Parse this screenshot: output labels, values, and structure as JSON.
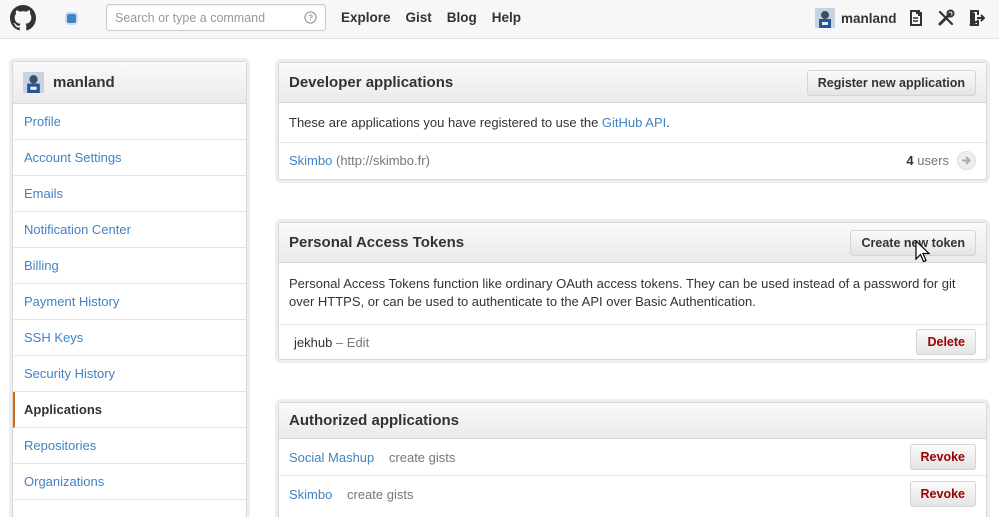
{
  "header": {
    "search_placeholder": "Search or type a command",
    "nav": [
      "Explore",
      "Gist",
      "Blog",
      "Help"
    ],
    "username": "manland",
    "icons": [
      "github-logo-icon",
      "repo-dot-icon",
      "help-circle-icon",
      "create-new-icon",
      "settings-tools-icon",
      "sign-out-icon"
    ],
    "accent": "#4183c4"
  },
  "sidebar": {
    "username": "manland",
    "items": [
      {
        "label": "Profile",
        "active": false
      },
      {
        "label": "Account Settings",
        "active": false
      },
      {
        "label": "Emails",
        "active": false
      },
      {
        "label": "Notification Center",
        "active": false
      },
      {
        "label": "Billing",
        "active": false
      },
      {
        "label": "Payment History",
        "active": false
      },
      {
        "label": "SSH Keys",
        "active": false
      },
      {
        "label": "Security History",
        "active": false
      },
      {
        "label": "Applications",
        "active": true
      },
      {
        "label": "Repositories",
        "active": false
      },
      {
        "label": "Organizations",
        "active": false
      }
    ],
    "active_accent": "#d26911"
  },
  "developer": {
    "title": "Developer applications",
    "button": "Register new application",
    "intro_before": "These are applications you have registered to use the ",
    "intro_link": "GitHub API",
    "intro_after": ".",
    "app": {
      "name": "Skimbo",
      "url": "(http://skimbo.fr)",
      "users_count": "4",
      "users_label": "users"
    }
  },
  "tokens": {
    "title": "Personal Access Tokens",
    "button": "Create new token",
    "description": "Personal Access Tokens function like ordinary OAuth access tokens. They can be used instead of a password for git over HTTPS, or can be used to authenticate to the API over Basic Authentication.",
    "token": {
      "name": "jekhub",
      "separator": " – ",
      "edit": "Edit",
      "delete": "Delete"
    }
  },
  "authorized": {
    "title": "Authorized applications",
    "apps": [
      {
        "name": "Social Mashup",
        "scope": "create gists",
        "revoke": "Revoke"
      },
      {
        "name": "Skimbo",
        "scope": "create gists",
        "revoke": "Revoke"
      }
    ],
    "danger_color": "#990000"
  }
}
